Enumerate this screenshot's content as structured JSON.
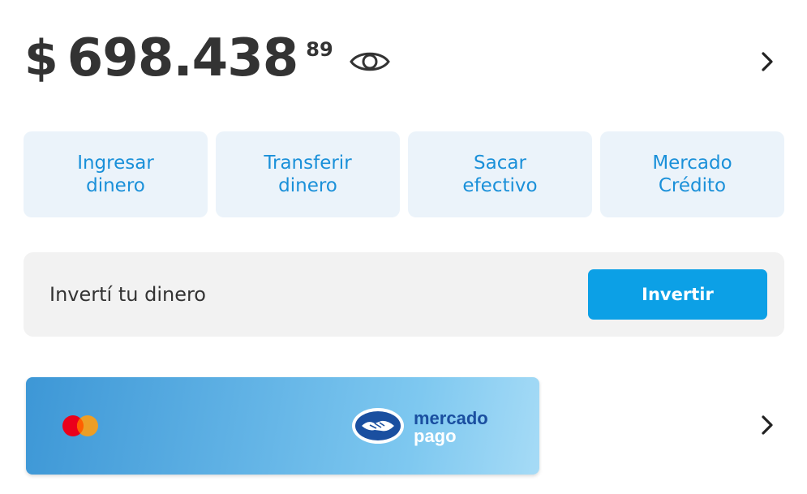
{
  "balance": {
    "currency": "$",
    "amount": "698.438",
    "cents": "89"
  },
  "icons": {
    "visibility": "eye-icon",
    "details": "chevron-right-icon"
  },
  "actions": [
    {
      "label": "Ingresar\ndinero"
    },
    {
      "label": "Transferir\ndinero"
    },
    {
      "label": "Sacar\nefectivo"
    },
    {
      "label": "Mercado\nCrédito"
    }
  ],
  "invest": {
    "label": "Invertí tu dinero",
    "button": "Invertir"
  },
  "card": {
    "brand_text_1": "mercado",
    "brand_text_2": "pago"
  },
  "colors": {
    "accent": "#1a90d9",
    "button": "#0ca0e6",
    "action_bg": "#ebf3fa",
    "invest_bg": "#f2f2f2",
    "text": "#333333"
  }
}
